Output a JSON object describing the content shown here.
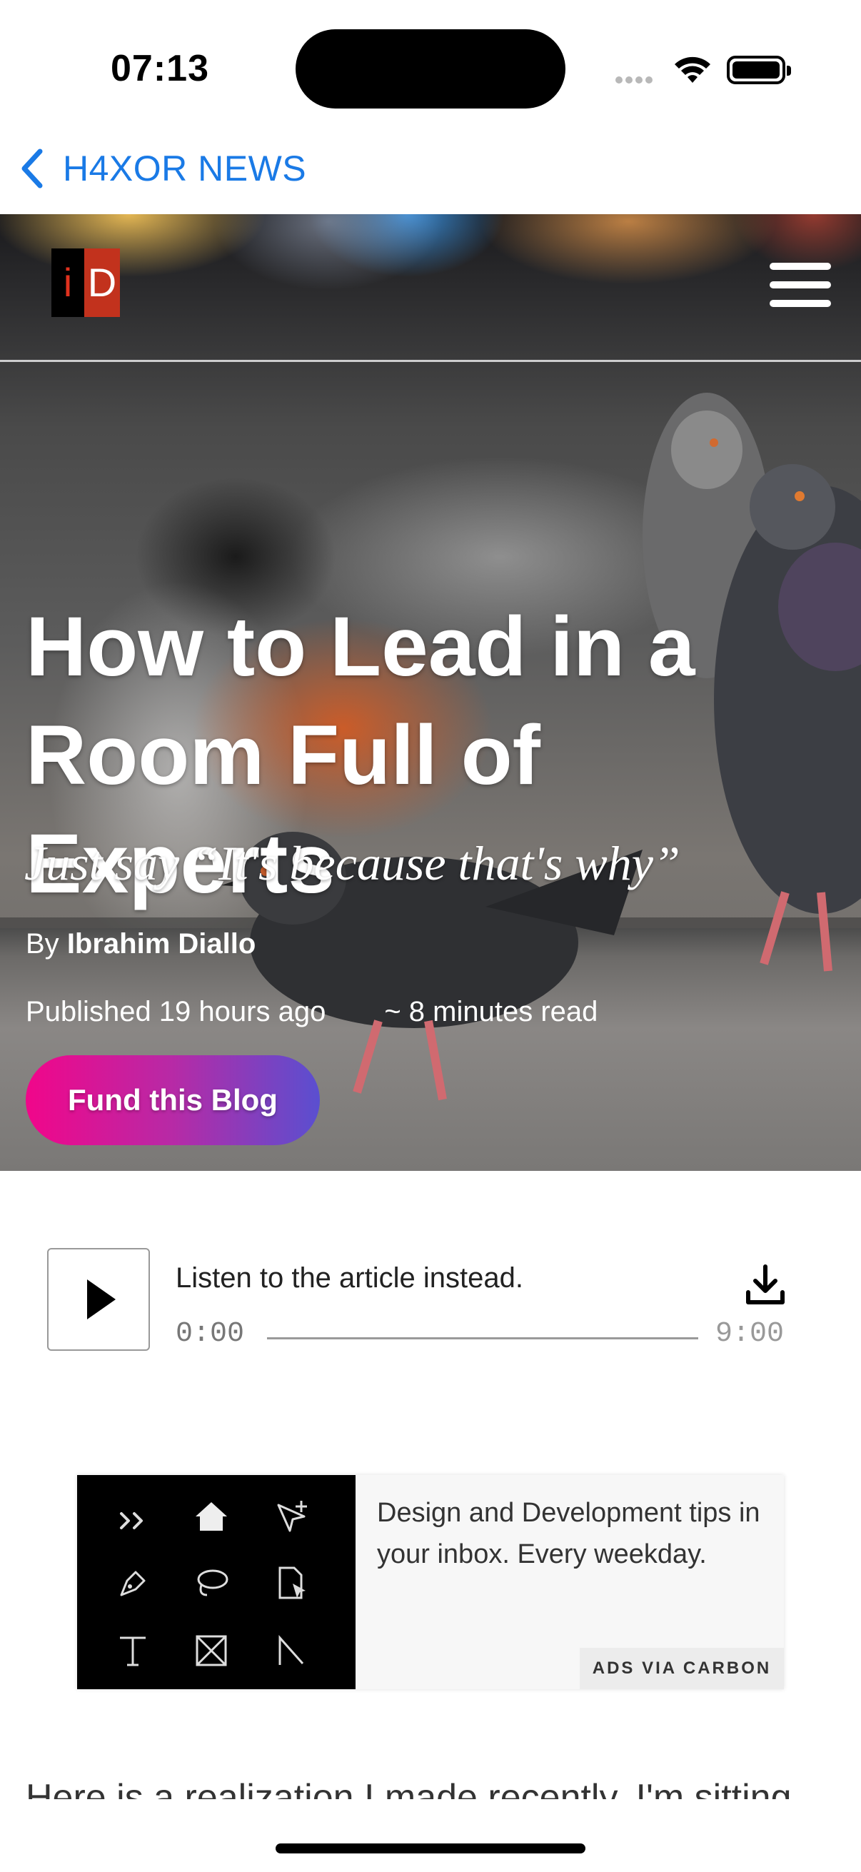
{
  "status_bar": {
    "time": "07:13"
  },
  "nav": {
    "back_label": "H4XOR NEWS"
  },
  "site": {
    "logo_left": "i",
    "logo_right": "D"
  },
  "article": {
    "title": "How to Lead in a Room Full of Experts",
    "subtitle": "Just say “It's because that's why”",
    "by_prefix": "By",
    "author": "Ibrahim Diallo",
    "published": "Published 19 hours ago",
    "read_time": "~ 8 minutes read",
    "fund_button": "Fund this Blog",
    "body_first_line": "Here is a realization I made recently. I'm sitting"
  },
  "audio": {
    "prompt": "Listen to the article instead.",
    "current_time": "0:00",
    "duration": "9:00",
    "progress": 0
  },
  "ad": {
    "text": "Design and Development tips in your inbox. Every weekday.",
    "via_label": "ADS VIA CARBON"
  },
  "colors": {
    "link_blue": "#1a7ae6",
    "fund_gradient_start": "#f1068a",
    "fund_gradient_end": "#5a4fd0"
  }
}
